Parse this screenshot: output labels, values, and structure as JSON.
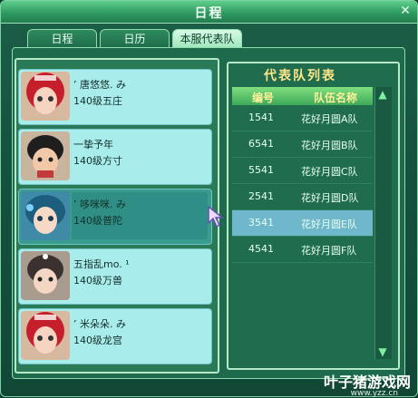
{
  "window": {
    "title": "日程"
  },
  "tabs": [
    {
      "label": "日程"
    },
    {
      "label": "日历"
    },
    {
      "label": "本服代表队"
    }
  ],
  "members": [
    {
      "name": "ʼ 唐悠悠. み",
      "level": "140级五庄"
    },
    {
      "name": "一挚予年",
      "level": "140级方寸"
    },
    {
      "name": "ʼ 哆咪咪. み",
      "level": "140级普陀"
    },
    {
      "name": "五指乱mo. ¹",
      "level": "140级万兽"
    },
    {
      "name": "ʼ 米朵朵. み",
      "level": "140级龙宫"
    }
  ],
  "team_list": {
    "title": "代表队列表",
    "headers": {
      "id": "编号",
      "name": "队伍名称"
    },
    "rows": [
      {
        "id": "1541",
        "name": "花好月圆A队"
      },
      {
        "id": "6541",
        "name": "花好月圆B队"
      },
      {
        "id": "5541",
        "name": "花好月圆C队"
      },
      {
        "id": "2541",
        "name": "花好月圆D队"
      },
      {
        "id": "3541",
        "name": "花好月圆E队"
      },
      {
        "id": "4541",
        "name": "花好月圆F队"
      }
    ]
  },
  "watermark": {
    "brand": "叶子猪游戏网",
    "url": "www.yzz.cn"
  }
}
